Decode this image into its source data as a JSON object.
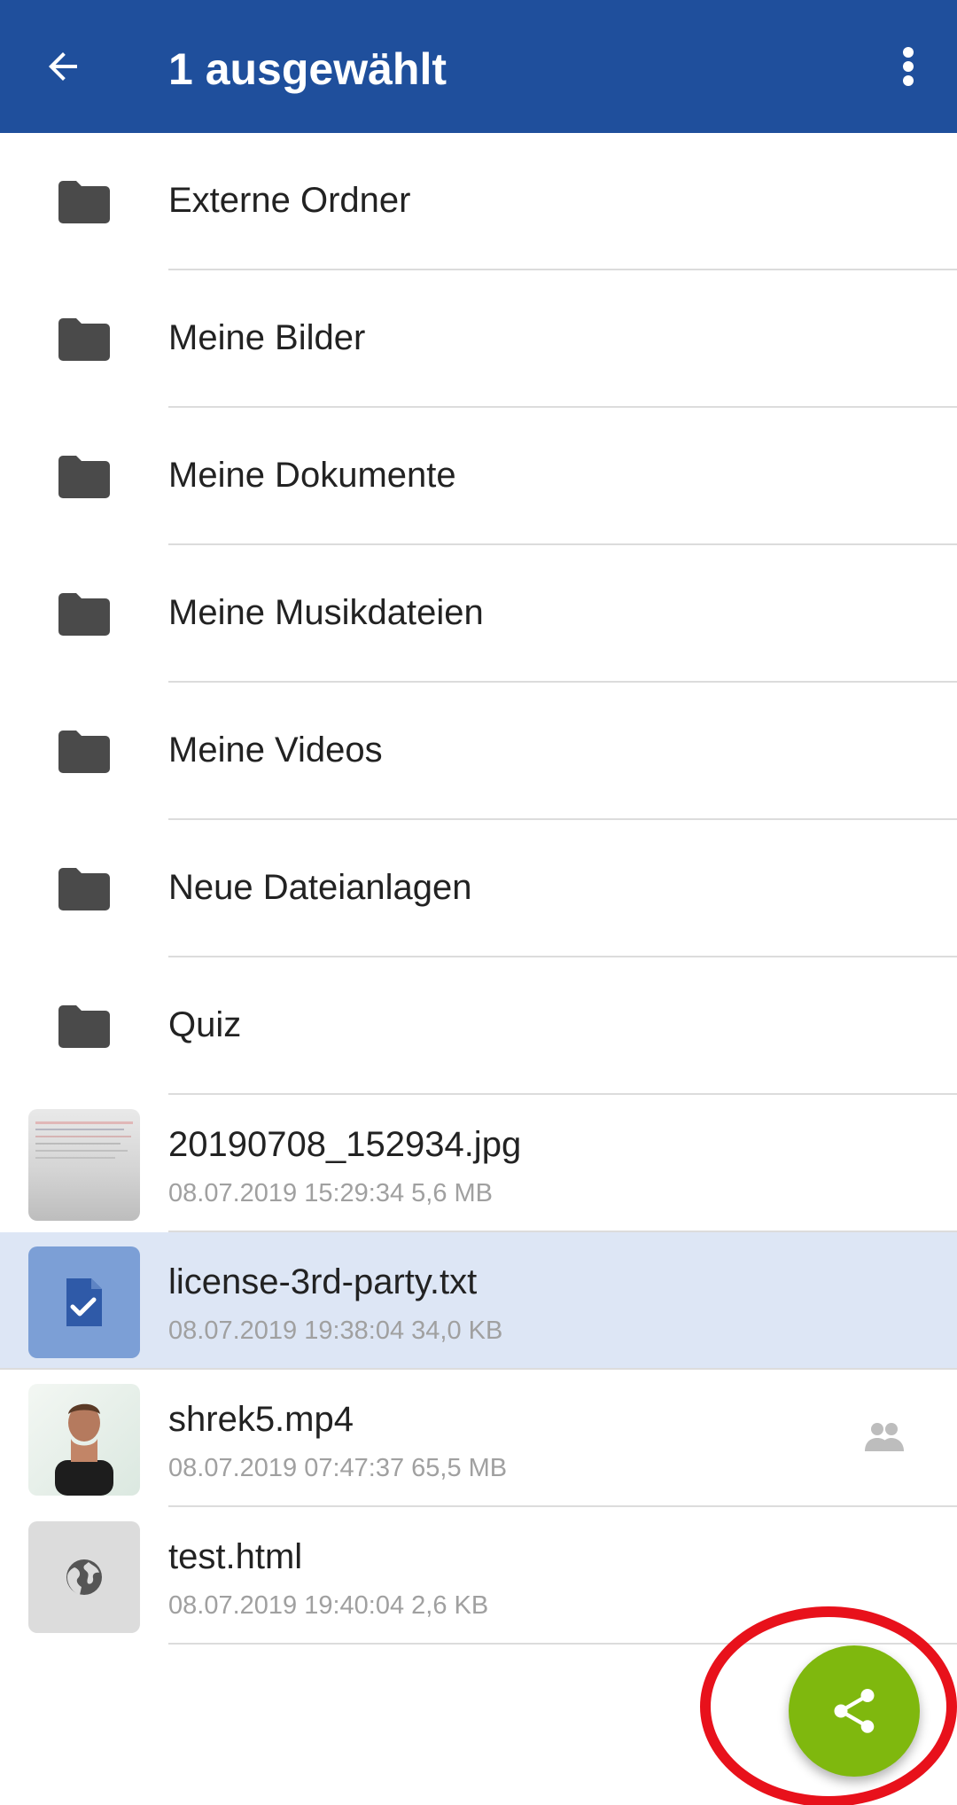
{
  "appbar": {
    "title": "1 ausgewählt",
    "color": "#1f4f9c",
    "back_icon": "arrow-left-icon",
    "menu_icon": "more-vert-icon"
  },
  "folders": [
    {
      "label": "Externe Ordner"
    },
    {
      "label": "Meine Bilder"
    },
    {
      "label": "Meine Dokumente"
    },
    {
      "label": "Meine Musikdateien"
    },
    {
      "label": "Meine Videos"
    },
    {
      "label": "Neue Dateianlagen"
    },
    {
      "label": "Quiz"
    }
  ],
  "files": [
    {
      "name": "20190708_152934.jpg",
      "meta": "08.07.2019 15:29:34 5,6 MB",
      "thumb": "photo-thumbnail",
      "selected": false,
      "shared": false
    },
    {
      "name": "license-3rd-party.txt",
      "meta": "08.07.2019 19:38:04 34,0 KB",
      "thumb": "checked-document-icon",
      "selected": true,
      "shared": false
    },
    {
      "name": "shrek5.mp4",
      "meta": "08.07.2019 07:47:37 65,5 MB",
      "thumb": "video-thumbnail",
      "selected": false,
      "shared": true
    },
    {
      "name": "test.html",
      "meta": "08.07.2019 19:40:04 2,6 KB",
      "thumb": "globe-icon",
      "selected": false,
      "shared": false
    }
  ],
  "fab": {
    "icon": "share-icon",
    "color": "#7fb80e",
    "highlight_color": "#e8111b"
  }
}
